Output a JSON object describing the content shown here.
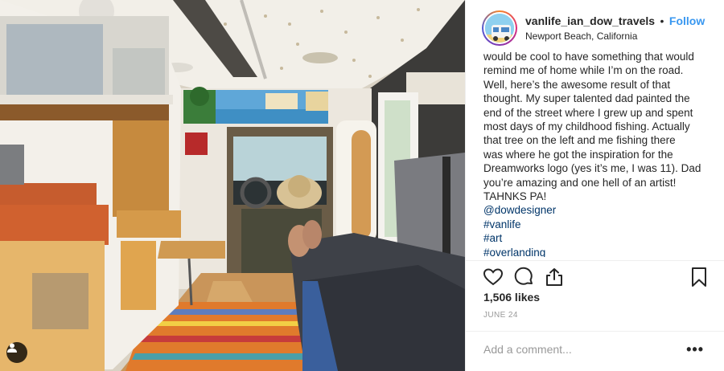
{
  "post": {
    "username": "vanlife_ian_dow_travels",
    "separator": "•",
    "follow_label": "Follow",
    "location": "Newport Beach, California",
    "caption_lines": [
      "would be cool to have something that would",
      "remind me of home while I’m on the road.",
      "Well, here’s the awesome result of that",
      "thought. My super talented dad painted the",
      "end of the street where I grew up and spent",
      "most days of my childhood fishing. Actually",
      "that tree on the left and me fishing there",
      "was where he got the inspiration for the",
      "Dreamworks logo (yes it’s me, I was 11). Dad",
      "you’re amazing and one hell of an artist!",
      "TAHNKS PA!"
    ],
    "mention": "@dowdesigner",
    "hashtags": [
      "#vanlife",
      "#art",
      "#overlanding"
    ],
    "likes": "1,506 likes",
    "date": "JUNE 24",
    "comment_placeholder": "Add a comment...",
    "more_label": "•••"
  },
  "icons": {
    "like": "heart-icon",
    "comment": "comment-icon",
    "share": "share-icon",
    "save": "bookmark-icon",
    "user_tag": "person-icon"
  },
  "colors": {
    "follow": "#3897f0",
    "hashtag": "#003569",
    "muted": "#999999"
  }
}
